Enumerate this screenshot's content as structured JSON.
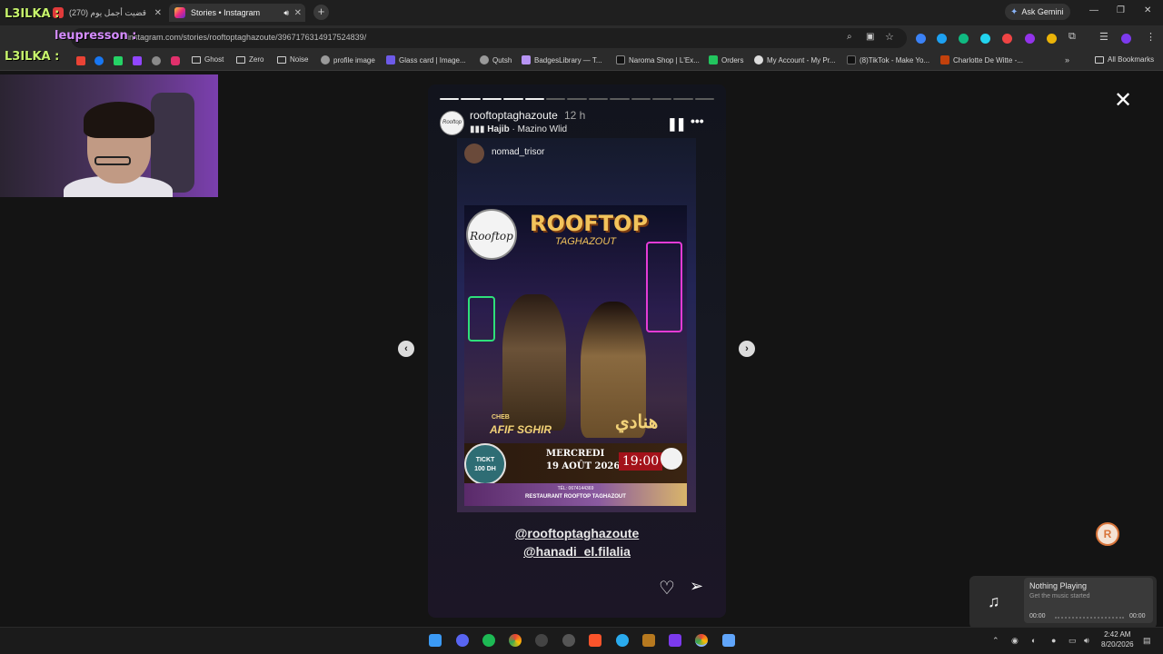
{
  "browser": {
    "tabs": [
      {
        "label": "(270) قضيت أجمل يوم",
        "active": false
      },
      {
        "label": "Stories • Instagram",
        "active": true
      }
    ],
    "ask_gemini": "Ask Gemini",
    "url": "instagram.com/stories/rooftoptaghazoute/3967176314917524839/",
    "bookmarks": [
      {
        "label": "Ghost",
        "kind": "folder"
      },
      {
        "label": "Zero",
        "kind": "folder"
      },
      {
        "label": "Noise",
        "kind": "folder"
      },
      {
        "label": "profile image",
        "kind": "link"
      },
      {
        "label": "Glass card | Image...",
        "kind": "link"
      },
      {
        "label": "Qutsh",
        "kind": "link"
      },
      {
        "label": "BadgesLibrary — T...",
        "kind": "link"
      },
      {
        "label": "Naroma Shop | L'Ex...",
        "kind": "link"
      },
      {
        "label": "Orders",
        "kind": "link"
      },
      {
        "label": "My Account - My Pr...",
        "kind": "link"
      },
      {
        "label": "(8)TikTok - Make Yo...",
        "kind": "link"
      },
      {
        "label": "Charlotte De Witte -...",
        "kind": "link"
      }
    ],
    "all_bookmarks": "All Bookmarks"
  },
  "overlay": {
    "line1": "L3ILKA :",
    "line2": "leupresson :",
    "line3": "L3ILKA :"
  },
  "story": {
    "username": "rooftoptaghazoute",
    "time": "12 h",
    "music_artist": "Hajib",
    "music_title": "· Mazino Wlid",
    "avatar_text": "Rooftop",
    "progress_total": 13,
    "progress_done": 5,
    "repost": {
      "username": "nomad_trisor",
      "poster": {
        "logo": "Rooftop",
        "title": "ROOFTOP",
        "subtitle": "TAGHAZOUT",
        "cheb": "CHEB",
        "artist1": "AFIF SGHIR",
        "artist2_ar": "هنادي",
        "ticket_line1": "TICKT",
        "ticket_line2": "100 DH",
        "day": "MERCREDI",
        "date": "19 AOÛT 2026",
        "time": "19:00",
        "tel": "TÉL: 0674144369",
        "restaurant": "RESTAURANT ROOFTOP TAGHAZOUT"
      }
    },
    "mention1": "@rooftoptaghazoute",
    "mention2": "@hanadi_el.filalia"
  },
  "media_widget": {
    "title": "Nothing Playing",
    "subtitle": "Get the music started",
    "time_start": "00:00",
    "time_end": "00:00"
  },
  "clock": {
    "time": "2:42 AM",
    "date": "8/20/2026"
  },
  "colors": {
    "overlay_green": "#c6f36b",
    "story_bg": "#12141d",
    "poster_gold": "#f2c35b"
  }
}
